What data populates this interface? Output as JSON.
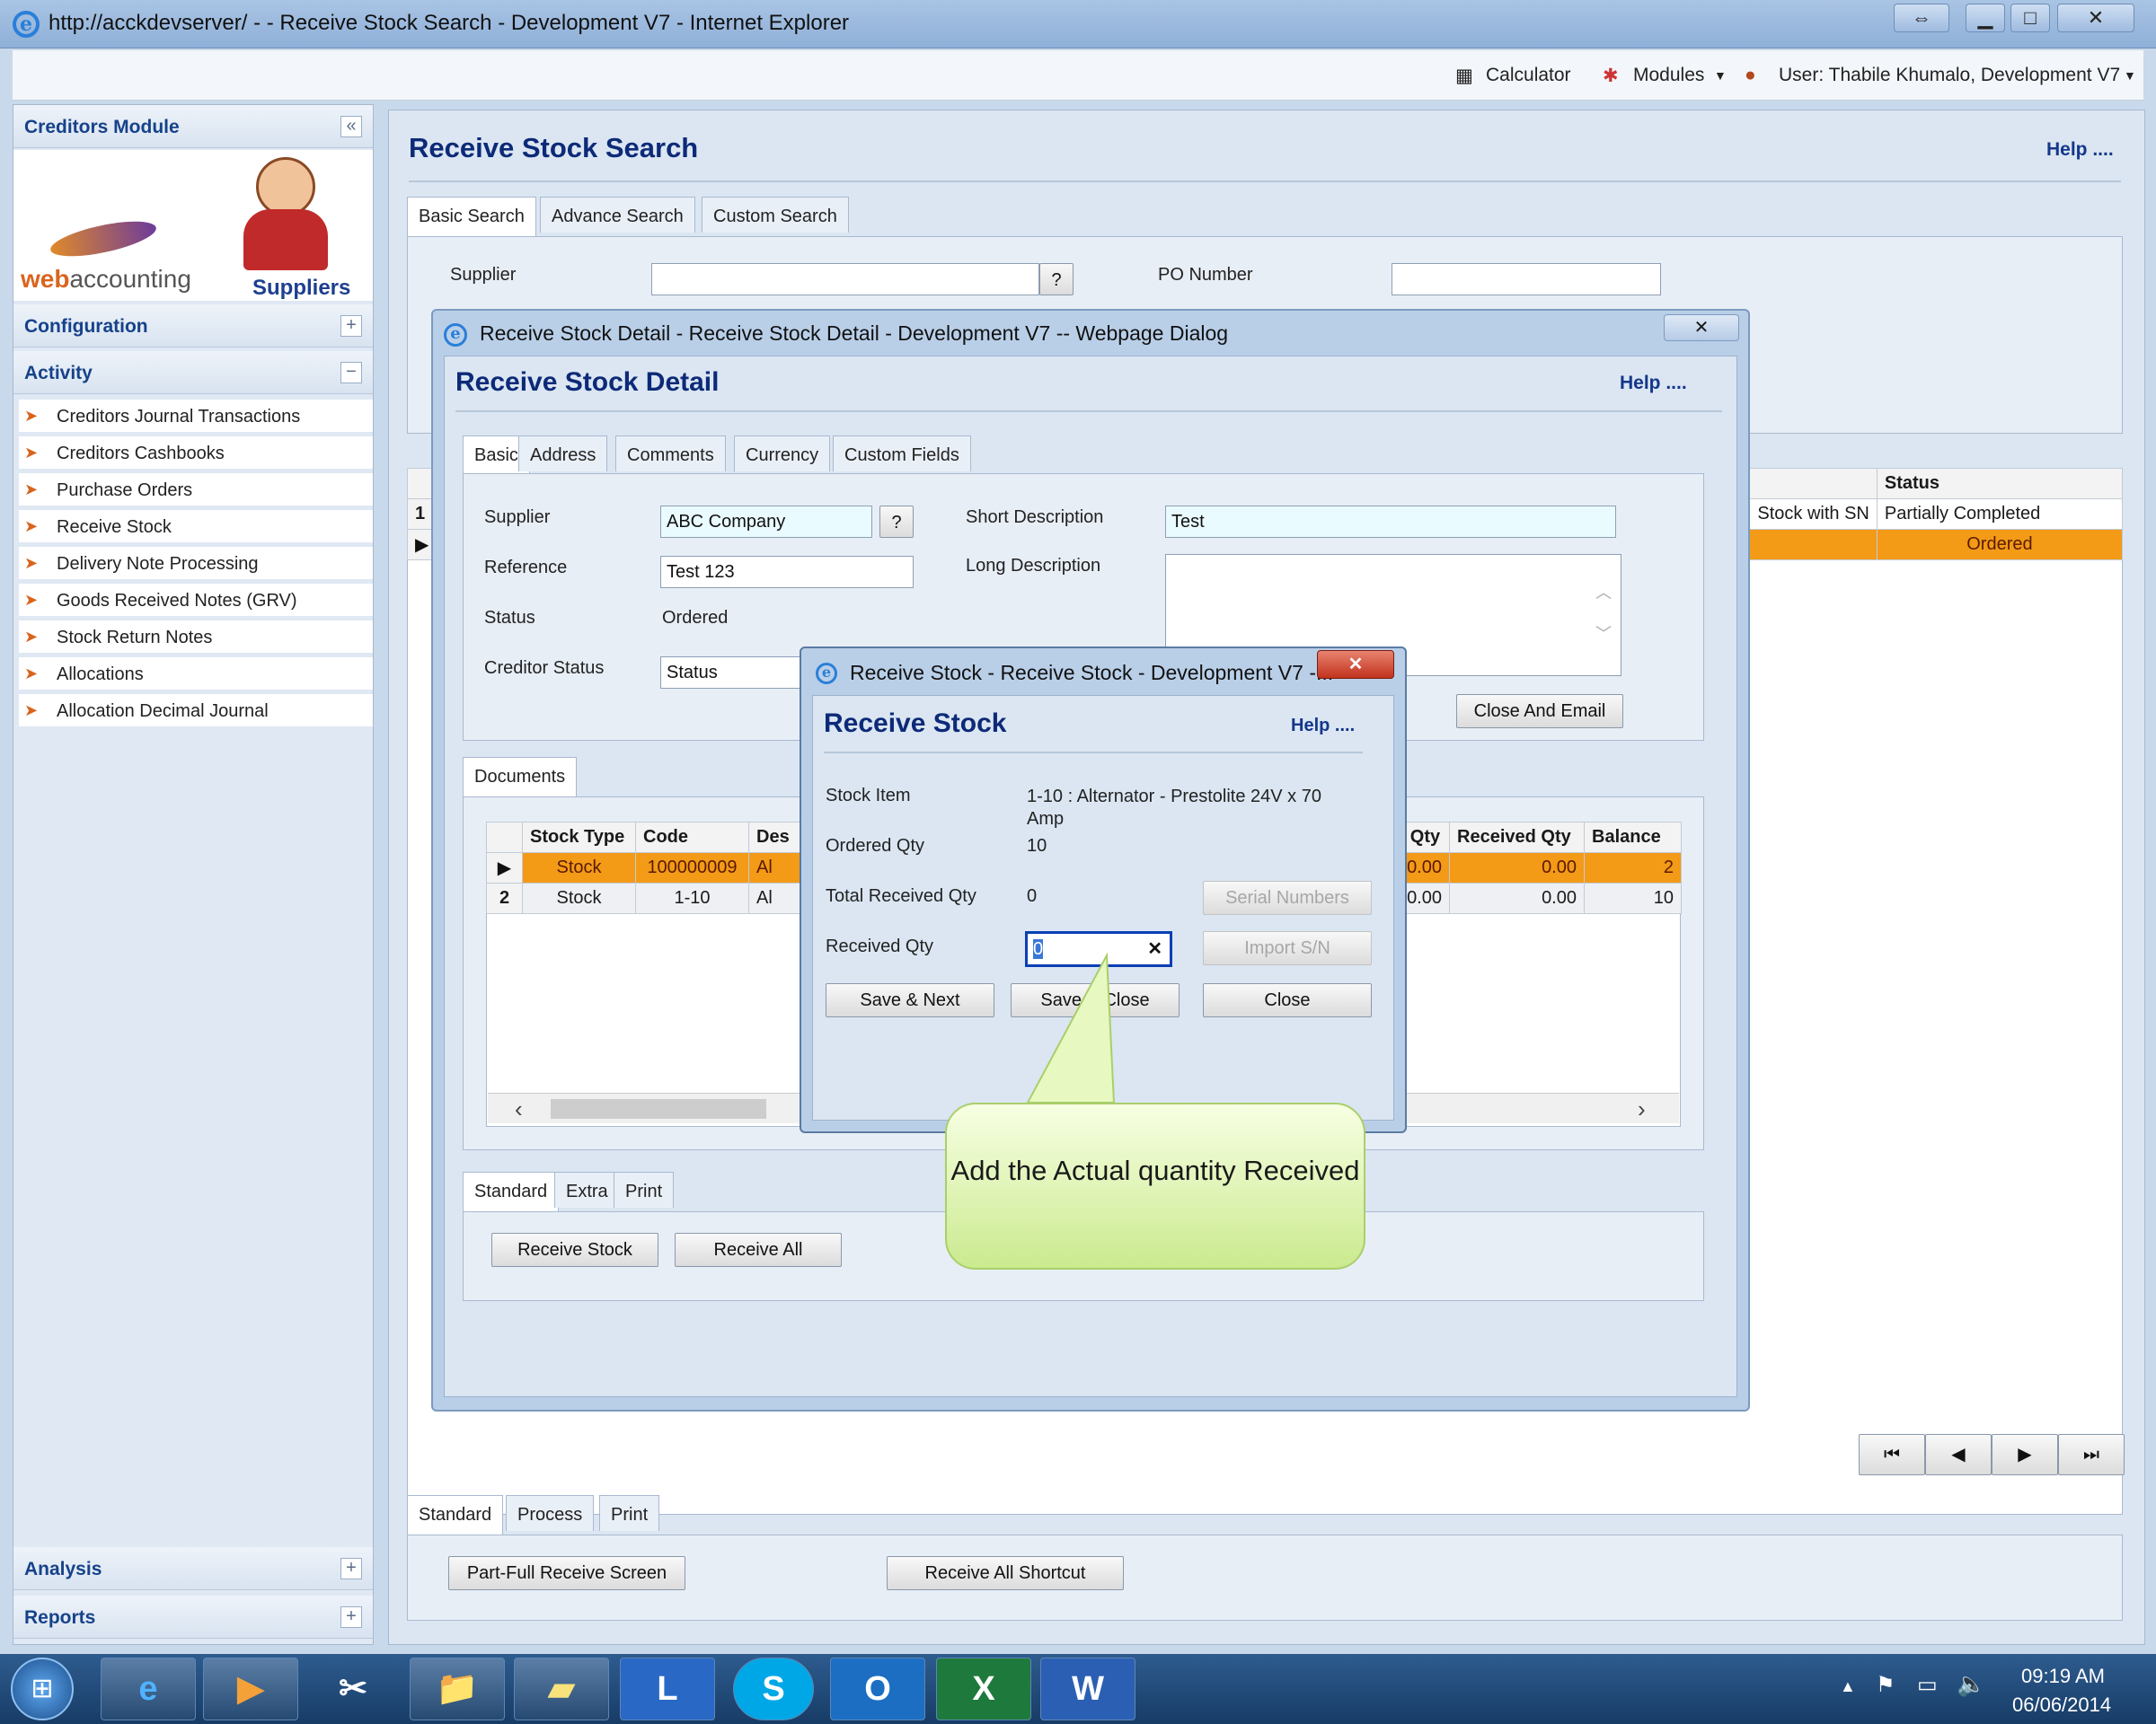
{
  "browser": {
    "title": "http://acckdevserver/ -  - Receive Stock Search - Development V7 - Internet Explorer"
  },
  "toolbar": {
    "calculator": "Calculator",
    "modules": "Modules",
    "user": "User: Thabile Khumalo, Development V7"
  },
  "sidebar": {
    "module_title": "Creditors Module",
    "logo_text_web": "web",
    "logo_text_accounting": "accounting",
    "suppliers_label": "Suppliers",
    "configuration": "Configuration",
    "activity": "Activity",
    "items": [
      {
        "label": "Creditors Journal Transactions"
      },
      {
        "label": "Creditors Cashbooks"
      },
      {
        "label": "Purchase Orders"
      },
      {
        "label": "Receive Stock"
      },
      {
        "label": "Delivery Note Processing"
      },
      {
        "label": "Goods Received Notes (GRV)"
      },
      {
        "label": "Stock Return Notes"
      },
      {
        "label": "Allocations"
      },
      {
        "label": "Allocation Decimal Journal"
      }
    ],
    "analysis": "Analysis",
    "reports": "Reports"
  },
  "search_page": {
    "title": "Receive Stock Search",
    "help": "Help ....",
    "tabs": [
      "Basic Search",
      "Advance Search",
      "Custom Search"
    ],
    "supplier_label": "Supplier",
    "supplier_btn": "?",
    "po_label": "PO Number",
    "grid_headers": {
      "status": "Status"
    },
    "rows": [
      {
        "num": "1",
        "desc_tail": "Stock with SN",
        "status": "Partially Completed"
      },
      {
        "num": "▶",
        "desc_tail": "",
        "status": "Ordered"
      }
    ],
    "bottom_tabs": [
      "Standard",
      "Process",
      "Print"
    ],
    "btn_part_full": "Part-Full Receive Screen",
    "btn_receive_all_shortcut": "Receive All Shortcut",
    "nav": [
      "⏮",
      "◀",
      "▶",
      "⏭"
    ]
  },
  "detail_dialog": {
    "window_title": "Receive Stock Detail - Receive Stock Detail - Development V7 -- Webpage Dialog",
    "title": "Receive Stock Detail",
    "help": "Help ....",
    "tabs": [
      "Basic",
      "Address",
      "Comments",
      "Currency",
      "Custom Fields"
    ],
    "supplier_label": "Supplier",
    "supplier_value": "ABC Company",
    "supplier_btn": "?",
    "reference_label": "Reference",
    "reference_value": "Test 123",
    "status_label": "Status",
    "status_value": "Ordered",
    "creditor_status_label": "Creditor Status",
    "creditor_status_value": "Status",
    "short_desc_label": "Short Description",
    "short_desc_value": "Test",
    "long_desc_label": "Long Description",
    "close_email_btn": "Close And Email",
    "documents_tab": "Documents",
    "grid_headers": [
      "Stock Type",
      "Code",
      "Des",
      "d Qty",
      "Received Qty",
      "Balance"
    ],
    "grid_rows": [
      {
        "marker": "▶",
        "type": "Stock",
        "code": "100000009",
        "desc": "Al",
        "ord": "0.00",
        "recv": "0.00",
        "bal": "2"
      },
      {
        "marker": "2",
        "type": "Stock",
        "code": "1-10",
        "desc": "Al",
        "ord": "0.00",
        "recv": "0.00",
        "bal": "10"
      }
    ],
    "bottom_tabs": [
      "Standard",
      "Extra",
      "Print"
    ],
    "btn_receive_stock": "Receive Stock",
    "btn_receive_all": "Receive All"
  },
  "receive_dialog": {
    "window_title": "Receive Stock - Receive Stock - Development V7 -...",
    "title": "Receive Stock",
    "help": "Help ....",
    "stock_item_label": "Stock Item",
    "stock_item_value": "1-10 : Alternator - Prestolite 24V x  70 Amp",
    "ordered_label": "Ordered Qty",
    "ordered_value": "10",
    "total_received_label": "Total Received Qty",
    "total_received_value": "0",
    "received_label": "Received Qty",
    "received_value": "0",
    "serial_btn": "Serial Numbers",
    "import_btn": "Import S/N",
    "save_next_btn": "Save & Next",
    "save_close_btn": "Save & Close",
    "close_btn": "Close"
  },
  "callout": {
    "text": "Add the Actual quantity Received"
  },
  "taskbar": {
    "time": "09:19 AM",
    "date": "06/06/2014",
    "apps": [
      "e",
      "▶",
      "✂",
      "📁",
      "▰",
      "L",
      "S",
      "O",
      "X",
      "W"
    ]
  }
}
